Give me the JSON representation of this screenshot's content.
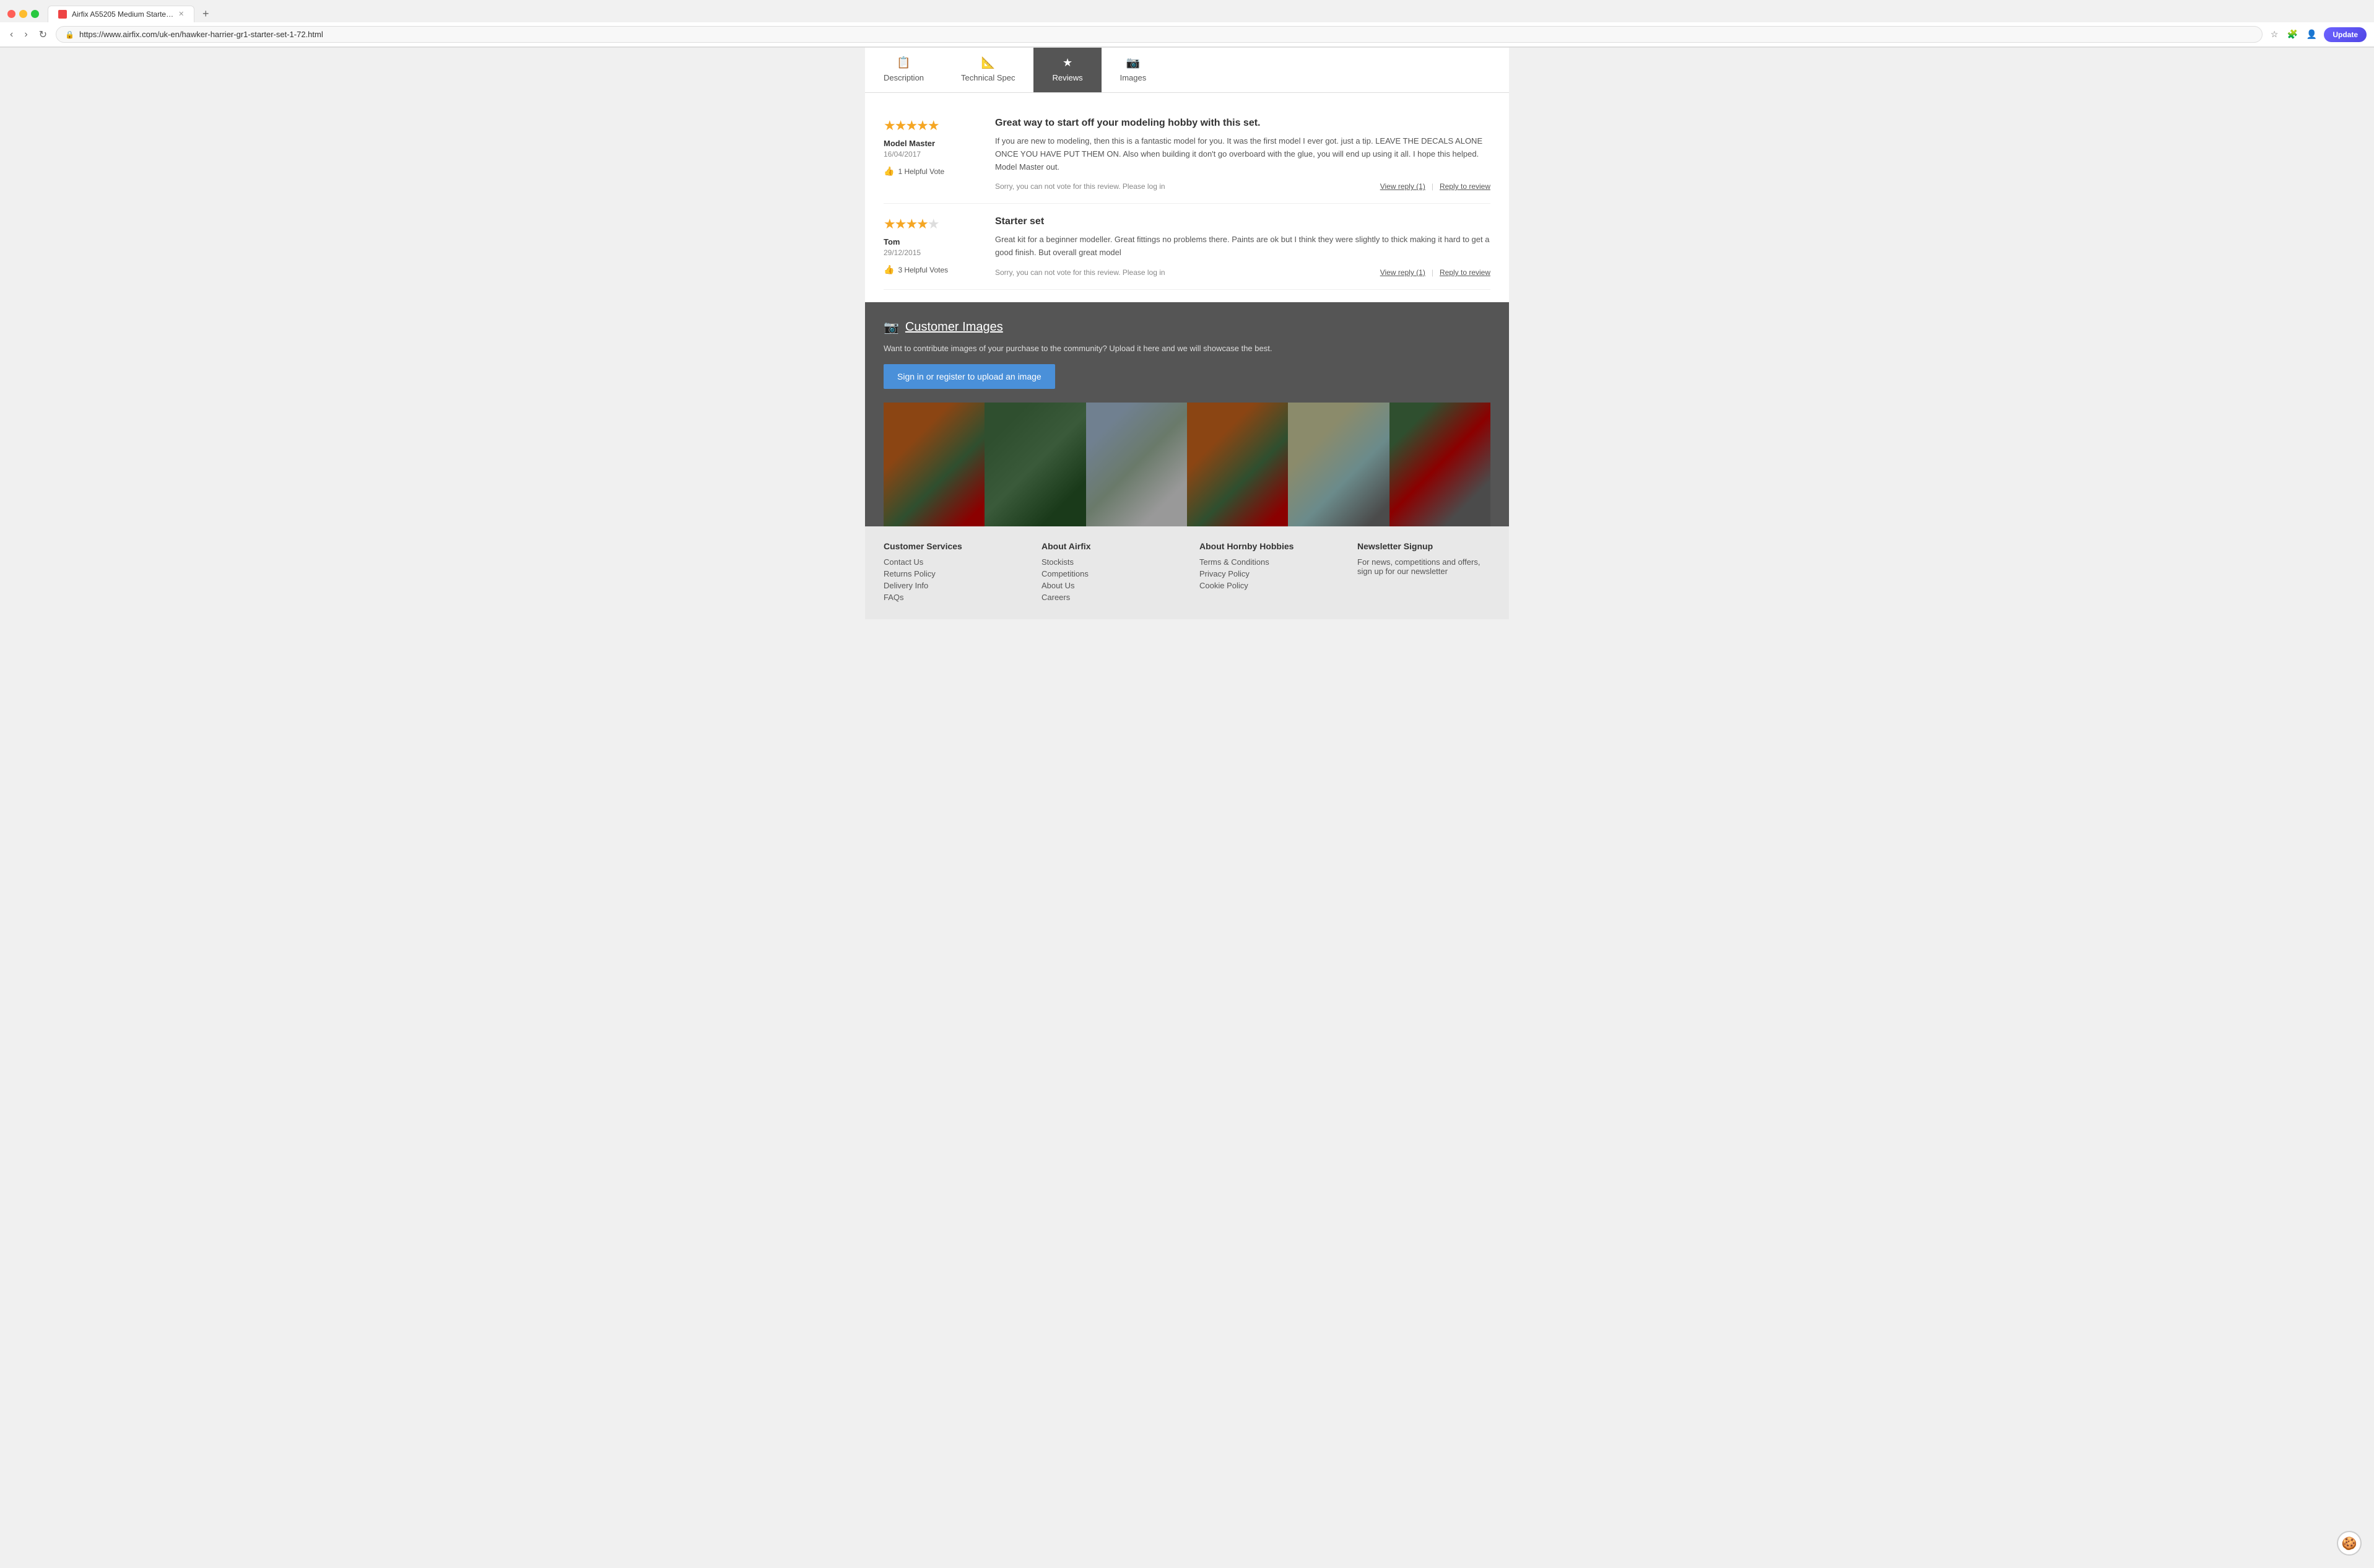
{
  "browser": {
    "tab_title": "Airfix A55205 Medium Starte…",
    "url": "https://www.airfix.com/uk-en/hawker-harrier-gr1-starter-set-1-72.html",
    "update_label": "Update"
  },
  "tabs": [
    {
      "id": "description",
      "label": "Description",
      "icon": "📋",
      "active": false
    },
    {
      "id": "technical-spec",
      "label": "Technical Spec",
      "icon": "📐",
      "active": false
    },
    {
      "id": "reviews",
      "label": "Reviews",
      "icon": "★",
      "active": true
    },
    {
      "id": "images",
      "label": "Images",
      "icon": "📷",
      "active": false
    }
  ],
  "reviews": [
    {
      "stars": 5,
      "author": "Model Master",
      "date": "16/04/2017",
      "helpful_votes": "1 Helpful Vote",
      "title": "Great way to start off your modeling hobby with this set.",
      "body": "If you are new to modeling, then this is a fantastic model for you. It was the first model I ever got. just a tip. LEAVE THE DECALS ALONE ONCE YOU HAVE PUT THEM ON. Also when building it don't go overboard with the glue, you will end up using it all. I hope this helped. Model Master out.",
      "vote_text": "Sorry, you can not vote for this review. Please log in",
      "view_reply": "View reply (1)",
      "reply_label": "Reply to review"
    },
    {
      "stars": 4,
      "author": "Tom",
      "date": "29/12/2015",
      "helpful_votes": "3 Helpful Votes",
      "title": "Starter set",
      "body": "Great kit for a beginner modeller. Great fittings no problems there. Paints are ok but I think they were slightly to thick making it hard to get a good finish. But overall great model",
      "vote_text": "Sorry, you can not vote for this review. Please log in",
      "view_reply": "View reply (1)",
      "reply_label": "Reply to review"
    }
  ],
  "customer_images": {
    "section_title": "Customer Images",
    "description": "Want to contribute images of your purchase to the community? Upload it here and we will showcase the best.",
    "upload_btn": "Sign in or register to upload an image",
    "images": [
      {
        "alt": "Hawker Harrier model image 1"
      },
      {
        "alt": "Hawker Harrier model image 2"
      },
      {
        "alt": "Hawker Harrier model image 3"
      },
      {
        "alt": "Hawker Harrier model image 4"
      },
      {
        "alt": "Hawker Harrier model image 5"
      },
      {
        "alt": "Hawker Harrier model image 6"
      }
    ]
  },
  "footer": {
    "columns": [
      {
        "title": "Customer Services",
        "links": [
          "Contact Us",
          "Returns Policy",
          "Delivery Info",
          "FAQs"
        ]
      },
      {
        "title": "About Airfix",
        "links": [
          "Stockists",
          "Competitions",
          "About Us",
          "Careers"
        ]
      },
      {
        "title": "About Hornby Hobbies",
        "links": [
          "Terms & Conditions",
          "Privacy Policy",
          "Cookie Policy"
        ]
      },
      {
        "title": "Newsletter Signup",
        "newsletter_text": "For news, competitions and offers,  sign up for our newsletter"
      }
    ]
  }
}
